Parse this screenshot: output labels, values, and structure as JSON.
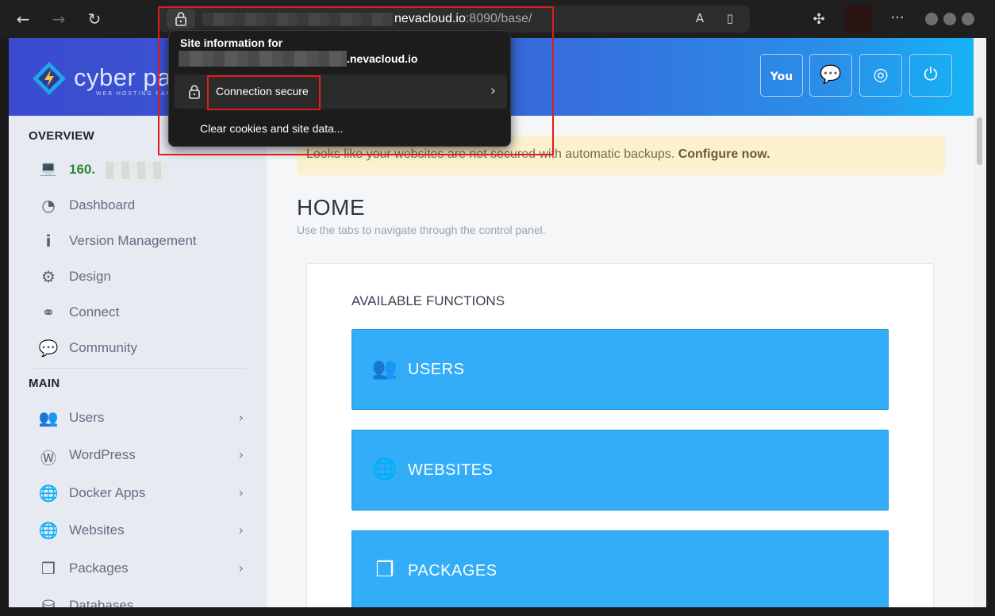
{
  "browser": {
    "url_domain": "nevacloud.io",
    "url_rest": ":8090/base/",
    "icons": [
      "back-icon",
      "forward-icon",
      "reload-icon",
      "lock-icon",
      "translate-icon",
      "reading-list-icon",
      "extensions-icon",
      "more-icon"
    ]
  },
  "site_info": {
    "title": "Site information for",
    "domain": ".nevacloud.io",
    "connection_label": "Connection secure",
    "clear_label": "Clear cookies and site data..."
  },
  "header": {
    "logo_text": "cyber pa",
    "logo_sub": "WEB HOSTING PAN",
    "buttons": [
      "youtube-icon",
      "chat-icon",
      "support-icon",
      "power-icon"
    ]
  },
  "sidebar": {
    "overview_title": "OVERVIEW",
    "ip_label": "160.",
    "overview_items": [
      {
        "label": "Dashboard",
        "icon": "dashboard-icon"
      },
      {
        "label": "Version Management",
        "icon": "info-icon"
      },
      {
        "label": "Design",
        "icon": "gear-icon"
      },
      {
        "label": "Connect",
        "icon": "link-icon"
      },
      {
        "label": "Community",
        "icon": "comments-icon"
      }
    ],
    "main_title": "MAIN",
    "main_items": [
      {
        "label": "Users",
        "icon": "users-icon"
      },
      {
        "label": "WordPress",
        "icon": "wordpress-icon"
      },
      {
        "label": "Docker Apps",
        "icon": "globe-icon"
      },
      {
        "label": "Websites",
        "icon": "globe-icon"
      },
      {
        "label": "Packages",
        "icon": "cubes-icon"
      },
      {
        "label": "Databases",
        "icon": "database-icon"
      }
    ]
  },
  "main": {
    "alert_text": "Looks like your websites are not secured with automatic backups.",
    "alert_link": "Configure now.",
    "title": "HOME",
    "subtitle": "Use the tabs to navigate through the control panel.",
    "functions_title": "AVAILABLE FUNCTIONS",
    "functions": [
      {
        "label": "USERS",
        "icon": "users-icon"
      },
      {
        "label": "WEBSITES",
        "icon": "globe-icon"
      },
      {
        "label": "PACKAGES",
        "icon": "cubes-icon"
      }
    ]
  }
}
